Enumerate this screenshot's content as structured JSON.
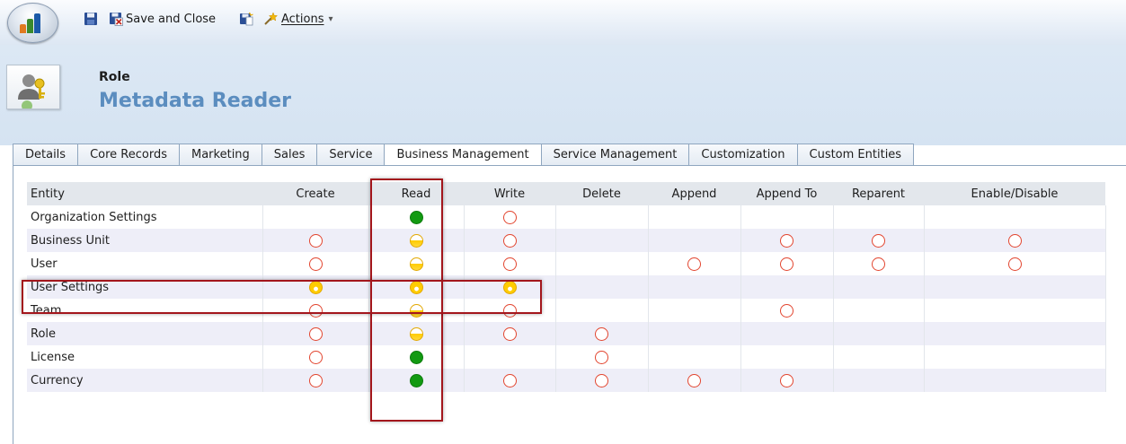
{
  "toolbar": {
    "save_and_close_label": "Save and Close",
    "actions_label": "Actions",
    "actions_dropdown_glyph": "▾"
  },
  "header": {
    "entity_type": "Role",
    "record_name": "Metadata Reader"
  },
  "tabs": [
    {
      "label": "Details",
      "active": false
    },
    {
      "label": "Core Records",
      "active": false
    },
    {
      "label": "Marketing",
      "active": false
    },
    {
      "label": "Sales",
      "active": false
    },
    {
      "label": "Service",
      "active": false
    },
    {
      "label": "Business Management",
      "active": true
    },
    {
      "label": "Service Management",
      "active": false
    },
    {
      "label": "Customization",
      "active": false
    },
    {
      "label": "Custom Entities",
      "active": false
    }
  ],
  "grid": {
    "columns": [
      "Entity",
      "Create",
      "Read",
      "Write",
      "Delete",
      "Append",
      "Append To",
      "Reparent",
      "Enable/Disable"
    ],
    "rows": [
      {
        "entity": "Organization Settings",
        "privileges": [
          "",
          "org",
          "none",
          "",
          "",
          "",
          "",
          ""
        ]
      },
      {
        "entity": "Business Unit",
        "privileges": [
          "none",
          "bu",
          "none",
          "",
          "",
          "none",
          "none",
          "none"
        ]
      },
      {
        "entity": "User",
        "privileges": [
          "none",
          "bu",
          "none",
          "",
          "none",
          "none",
          "none",
          "none"
        ]
      },
      {
        "entity": "User Settings",
        "privileges": [
          "user",
          "user",
          "user",
          "",
          "",
          "",
          "",
          ""
        ]
      },
      {
        "entity": "Team",
        "privileges": [
          "none",
          "bu",
          "none",
          "",
          "",
          "none",
          "",
          ""
        ]
      },
      {
        "entity": "Role",
        "privileges": [
          "none",
          "bu",
          "none",
          "none",
          "",
          "",
          "",
          ""
        ]
      },
      {
        "entity": "License",
        "privileges": [
          "none",
          "org",
          "",
          "none",
          "",
          "",
          "",
          ""
        ]
      },
      {
        "entity": "Currency",
        "privileges": [
          "none",
          "org",
          "none",
          "none",
          "none",
          "none",
          "",
          ""
        ]
      }
    ]
  },
  "colors": {
    "privilege_none": "#e2452f",
    "privilege_org": "#129a12",
    "privilege_bu": "#ffcc00",
    "privilege_user": "#ffcc00",
    "highlight": "#a3161c",
    "record_name": "#5b8dbf"
  }
}
